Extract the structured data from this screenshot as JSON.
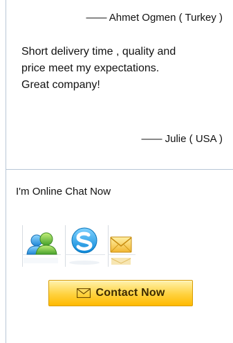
{
  "testimonials": [
    {
      "signature": "—— Ahmet Ogmen ( Turkey )"
    },
    {
      "quote_lines": [
        "Short delivery time , quality and",
        "price meet my expectations.",
        "Great company!"
      ],
      "signature": "—— Julie ( USA )"
    }
  ],
  "chat": {
    "heading": "I'm Online Chat Now",
    "icons": [
      "msn-messenger-icon",
      "skype-icon",
      "email-icon"
    ]
  },
  "contact_button": {
    "label": "Contact Now",
    "icon": "envelope-icon"
  },
  "colors": {
    "divider": "#b7c6d6",
    "button_top": "#fff2ad",
    "button_bottom": "#ffb900",
    "button_border": "#d89c00",
    "skype_blue": "#14a0e8",
    "msn_green": "#5fae2f"
  }
}
